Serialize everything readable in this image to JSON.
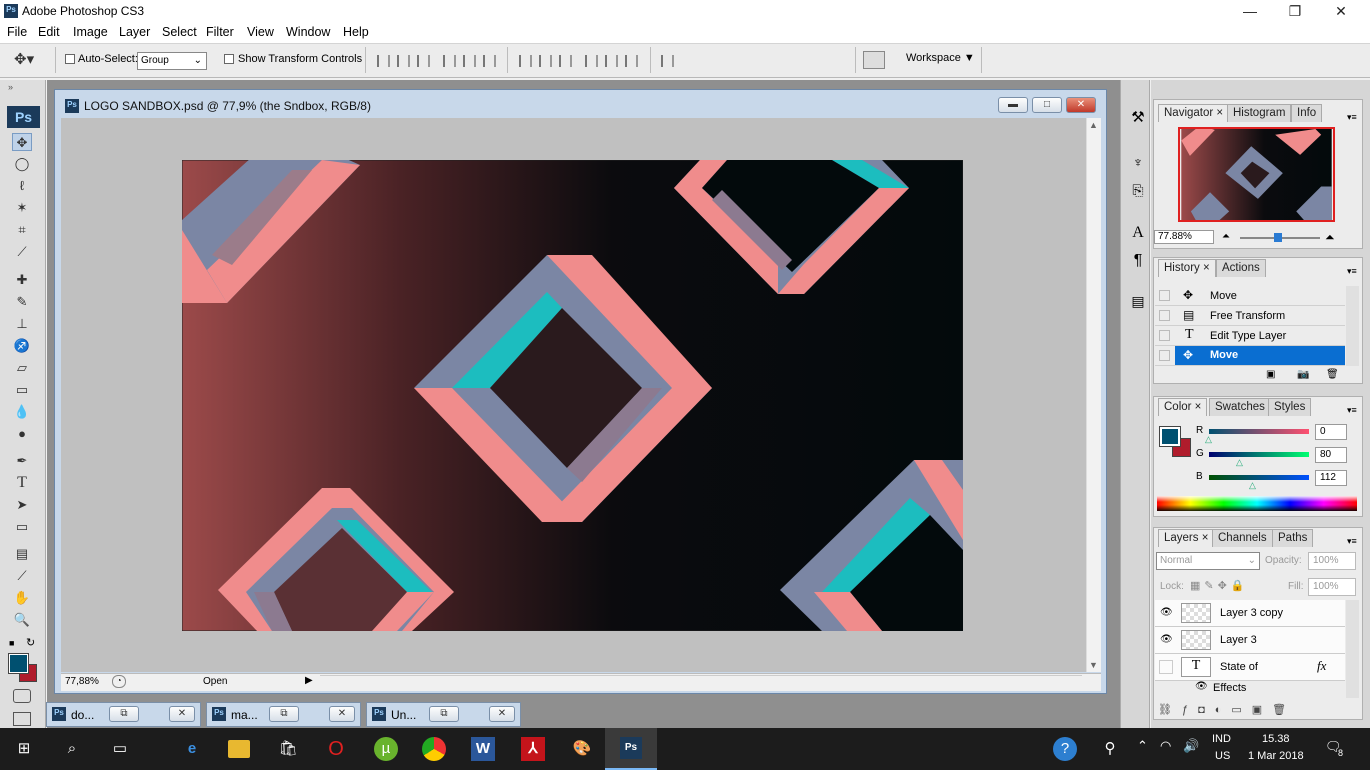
{
  "app": {
    "title": "Adobe Photoshop CS3",
    "icon_text": "Ps"
  },
  "window_controls": {
    "minimize": "—",
    "maximize": "❐",
    "close": "✕"
  },
  "menu": [
    "File",
    "Edit",
    "Image",
    "Layer",
    "Select",
    "Filter",
    "View",
    "Window",
    "Help"
  ],
  "options": {
    "auto_select_label": "Auto-Select:",
    "auto_select_value": "Group",
    "show_transform_label": "Show Transform Controls",
    "workspace_label": "Workspace ▼"
  },
  "document": {
    "title": "LOGO SANDBOX.psd @ 77,9% (the Sndbox, RGB/8)",
    "zoom": "77,88%",
    "status": "Open"
  },
  "minimized_docs": [
    "do...",
    "ma...",
    "Un..."
  ],
  "navigator": {
    "tabs": [
      "Navigator",
      "Histogram",
      "Info"
    ],
    "zoom": "77.88%"
  },
  "history": {
    "tabs": [
      "History",
      "Actions"
    ],
    "items": [
      {
        "label": "Move"
      },
      {
        "label": "Free Transform"
      },
      {
        "label": "Edit Type Layer"
      },
      {
        "label": "Move"
      }
    ]
  },
  "color": {
    "tabs": [
      "Color",
      "Swatches",
      "Styles"
    ],
    "r_label": "R",
    "g_label": "G",
    "b_label": "B",
    "r": "0",
    "g": "80",
    "b": "112",
    "fg": "#005070",
    "bg": "#b01c2c"
  },
  "layers": {
    "tabs": [
      "Layers",
      "Channels",
      "Paths"
    ],
    "blend_mode": "Normal",
    "opacity_label": "Opacity:",
    "opacity": "100%",
    "lock_label": "Lock:",
    "fill_label": "Fill:",
    "fill": "100%",
    "items": [
      {
        "name": "Layer 3 copy"
      },
      {
        "name": "Layer 3"
      },
      {
        "name": "State of",
        "fx": "fx"
      }
    ],
    "effects_label": "Effects"
  },
  "taskbar": {
    "lang_top": "IND",
    "lang_bottom": "US",
    "time": "15.38",
    "date": "1 Mar 2018",
    "notifications": "8"
  }
}
